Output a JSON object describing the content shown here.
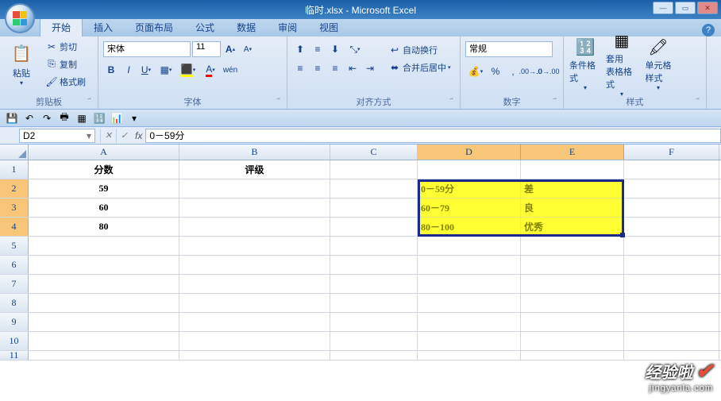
{
  "title": "临时.xlsx - Microsoft Excel",
  "tabs": {
    "home": "开始",
    "insert": "插入",
    "layout": "页面布局",
    "formula": "公式",
    "data": "数据",
    "review": "审阅",
    "view": "视图"
  },
  "clipboard": {
    "paste": "粘贴",
    "cut": "剪切",
    "copy": "复制",
    "format_painter": "格式刷",
    "group_label": "剪贴板"
  },
  "font": {
    "name": "宋体",
    "size": "11",
    "group_label": "字体"
  },
  "align": {
    "wrap": "自动换行",
    "merge": "合并后居中",
    "group_label": "对齐方式"
  },
  "number": {
    "format": "常规",
    "group_label": "数字"
  },
  "styles": {
    "cond": "条件格式",
    "table": "套用\n表格格式",
    "cell": "单元格\n样式",
    "group_label": "样式"
  },
  "name_box": "D2",
  "formula": "0－59分",
  "columns": [
    "A",
    "B",
    "C",
    "D",
    "E",
    "F"
  ],
  "headers": {
    "A": "分数",
    "B": "评级"
  },
  "rows": {
    "r2": {
      "A": "59"
    },
    "r3": {
      "A": "60"
    },
    "r4": {
      "A": "80"
    }
  },
  "selection": {
    "d2": "0－59分",
    "e2": "差",
    "d3": "60－79",
    "e3": "良",
    "d4": "80－100",
    "e4": "优秀"
  },
  "watermark": {
    "main": "经验啦",
    "sub": "jingyanla.com"
  }
}
